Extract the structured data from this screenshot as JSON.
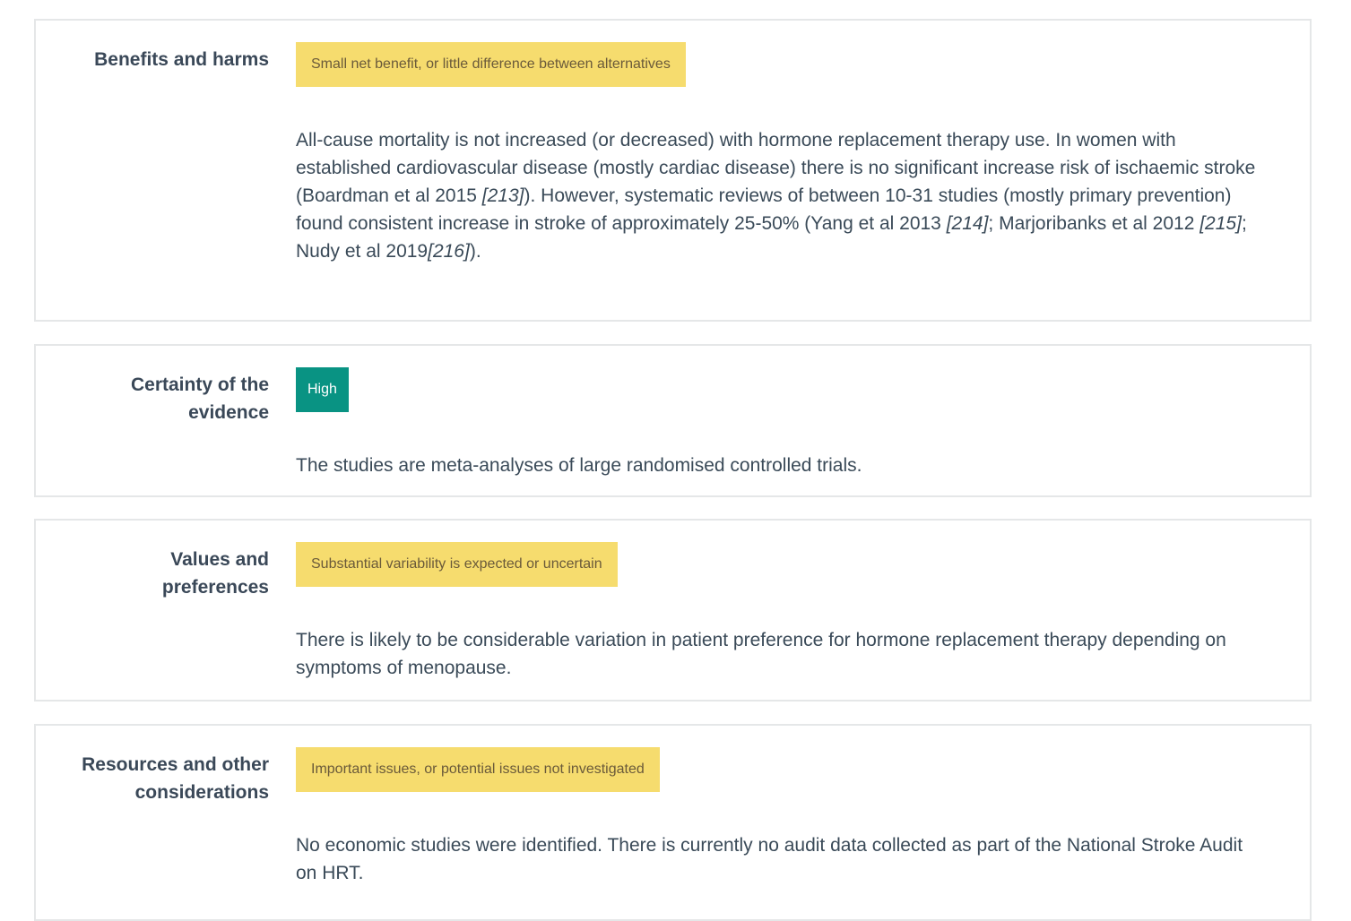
{
  "sections": [
    {
      "label": "Benefits and harms",
      "badge": "Small net benefit, or little difference between alternatives",
      "badge_color": "#f6dc6e",
      "text": {
        "p1": "All-cause mortality is not increased (or decreased) with hormone replacement therapy use. In women with established cardiovascular disease (mostly cardiac disease) there is no significant increase risk of ischaemic stroke (Boardman et al 2015 ",
        "c1": "[213]",
        "p2": "). However, systematic reviews of between 10-31 studies (mostly primary prevention) found consistent increase in stroke of approximately 25-50% (Yang et al 2013 ",
        "c2": "[214]",
        "p3": "; Marjoribanks et al 2012 ",
        "c3": "[215]",
        "p4": "; Nudy et al 2019",
        "c4": "[216]",
        "p5": ")."
      }
    },
    {
      "label_line1": "Certainty of the",
      "label_line2": "evidence",
      "badge": "High",
      "badge_color": "#099383",
      "text": "The studies are meta-analyses of large randomised controlled trials."
    },
    {
      "label_line1": "Values and",
      "label_line2": "preferences",
      "badge": "Substantial variability is expected or uncertain",
      "badge_color": "#f6dc6e",
      "text": "There is likely to be considerable variation in patient preference for hormone replacement therapy depending on symptoms of menopause."
    },
    {
      "label_line1": "Resources and other",
      "label_line2": "considerations",
      "badge": "Important issues, or potential issues not investigated",
      "badge_color": "#f6dc6e",
      "text": "No economic studies were identified. There is currently no audit data collected as part of the National Stroke Audit on HRT."
    }
  ]
}
